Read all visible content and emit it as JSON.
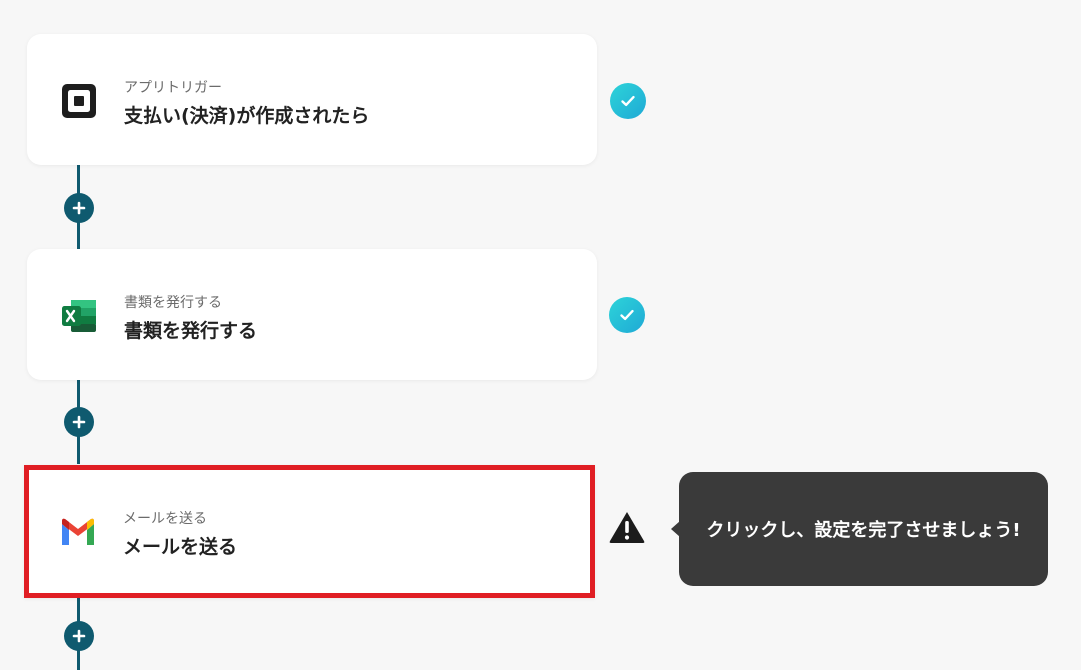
{
  "steps": [
    {
      "subtitle": "アプリトリガー",
      "title": "支払い(決済)が作成されたら",
      "icon": "square-pos-icon",
      "status": "complete"
    },
    {
      "subtitle": "書類を発行する",
      "title": "書類を発行する",
      "icon": "excel-icon",
      "status": "complete"
    },
    {
      "subtitle": "メールを送る",
      "title": "メールを送る",
      "icon": "gmail-icon",
      "status": "incomplete"
    }
  ],
  "tooltip": {
    "text": "クリックし、設定を完了させましょう!"
  },
  "colors": {
    "connector": "#0f5a6f",
    "check": "#22c1d8",
    "highlight": "#e01e24",
    "tooltip_bg": "#3a3a3a"
  }
}
